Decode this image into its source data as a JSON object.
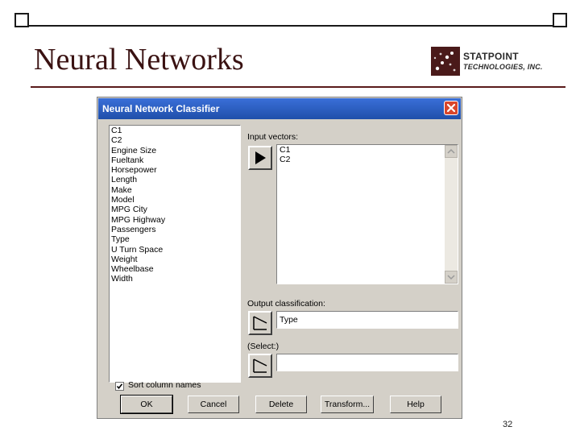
{
  "slide": {
    "title": "Neural Networks",
    "page_number": "32",
    "logo": {
      "line1": "STATPOINT",
      "line2": "TECHNOLOGIES, INC."
    }
  },
  "dialog": {
    "title": "Neural Network Classifier",
    "variables": [
      "C1",
      "C2",
      "Engine Size",
      "Fueltank",
      "Horsepower",
      "Length",
      "Make",
      "Model",
      "MPG City",
      "MPG Highway",
      "Passengers",
      "Type",
      "U Turn Space",
      "Weight",
      "Wheelbase",
      "Width"
    ],
    "input_vectors_label": "Input vectors:",
    "input_vectors": [
      "C1",
      "C2"
    ],
    "output_label": "Output classification:",
    "output_value": "Type",
    "select_label": "(Select:)",
    "select_value": "",
    "sort_label": "Sort column names",
    "sort_checked": true,
    "buttons": {
      "ok": "OK",
      "cancel": "Cancel",
      "delete": "Delete",
      "transform": "Transform...",
      "help": "Help"
    }
  }
}
